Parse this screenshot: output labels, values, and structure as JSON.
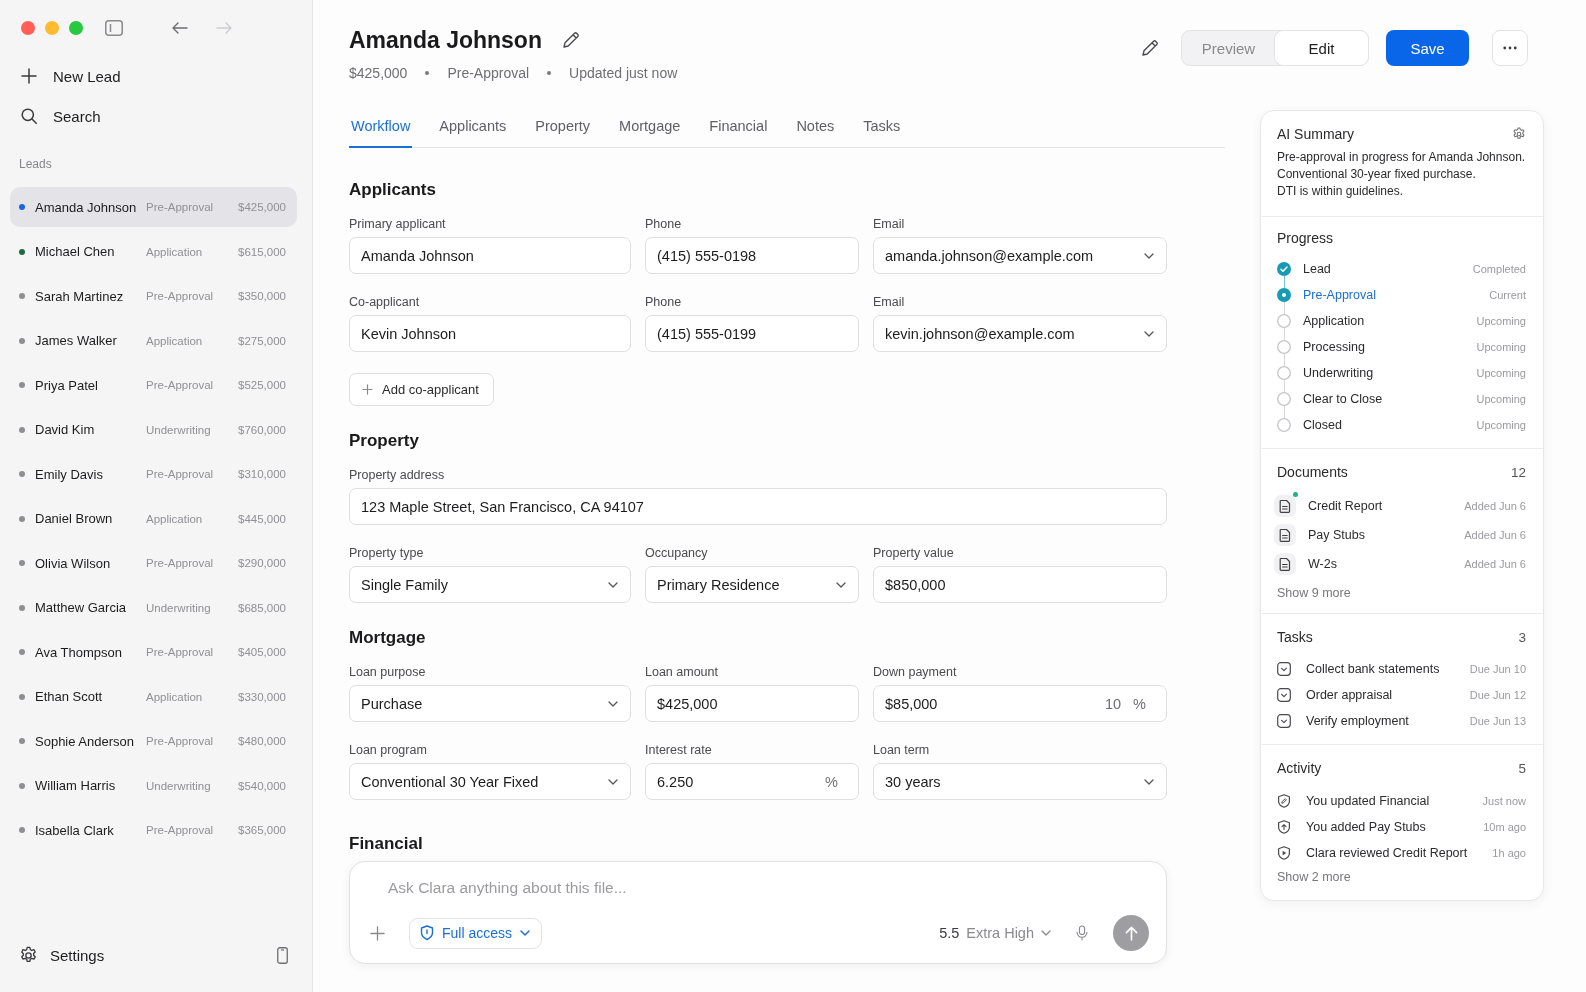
{
  "window": {
    "nav": [
      {
        "kind": "back",
        "disabled": false
      },
      {
        "kind": "forward",
        "disabled": true
      }
    ]
  },
  "sidebar": {
    "actions": [
      {
        "kind": "new",
        "label": "New Lead"
      },
      {
        "kind": "search",
        "label": "Search"
      }
    ],
    "section_label": "Leads",
    "leads": [
      {
        "name": "Amanda Johnson",
        "stage": "Pre-Approval",
        "amount": "$425,000",
        "color": "#1a66e0",
        "selected": true
      },
      {
        "name": "Michael Chen",
        "stage": "Application",
        "amount": "$615,000",
        "color": "#1c6b45",
        "selected": false
      },
      {
        "name": "Sarah Martinez",
        "stage": "Pre-Approval",
        "amount": "$350,000",
        "color": "#8e8e93",
        "selected": false
      },
      {
        "name": "James Walker",
        "stage": "Application",
        "amount": "$275,000",
        "color": "#8e8e93",
        "selected": false
      },
      {
        "name": "Priya Patel",
        "stage": "Pre-Approval",
        "amount": "$525,000",
        "color": "#8e8e93",
        "selected": false
      },
      {
        "name": "David Kim",
        "stage": "Underwriting",
        "amount": "$760,000",
        "color": "#8e8e93",
        "selected": false
      },
      {
        "name": "Emily Davis",
        "stage": "Pre-Approval",
        "amount": "$310,000",
        "color": "#8e8e93",
        "selected": false
      },
      {
        "name": "Daniel Brown",
        "stage": "Application",
        "amount": "$445,000",
        "color": "#8e8e93",
        "selected": false
      },
      {
        "name": "Olivia Wilson",
        "stage": "Pre-Approval",
        "amount": "$290,000",
        "color": "#8e8e93",
        "selected": false
      },
      {
        "name": "Matthew Garcia",
        "stage": "Underwriting",
        "amount": "$685,000",
        "color": "#8e8e93",
        "selected": false
      },
      {
        "name": "Ava Thompson",
        "stage": "Pre-Approval",
        "amount": "$405,000",
        "color": "#8e8e93",
        "selected": false
      },
      {
        "name": "Ethan Scott",
        "stage": "Application",
        "amount": "$330,000",
        "color": "#8e8e93",
        "selected": false
      },
      {
        "name": "Sophie Anderson",
        "stage": "Pre-Approval",
        "amount": "$480,000",
        "color": "#8e8e93",
        "selected": false
      },
      {
        "name": "William Harris",
        "stage": "Underwriting",
        "amount": "$540,000",
        "color": "#8e8e93",
        "selected": false
      },
      {
        "name": "Isabella Clark",
        "stage": "Pre-Approval",
        "amount": "$365,000",
        "color": "#8e8e93",
        "selected": false
      }
    ],
    "settings_label": "Settings"
  },
  "header": {
    "title": "Amanda Johnson",
    "meta": [
      "$425,000",
      "Pre-Approval",
      "Updated just now"
    ],
    "view_modes": [
      {
        "label": "Preview",
        "selected": false
      },
      {
        "label": "Edit",
        "selected": true
      }
    ],
    "save_label": "Save"
  },
  "tabs": [
    {
      "label": "Workflow",
      "selected": true
    },
    {
      "label": "Applicants",
      "selected": false
    },
    {
      "label": "Property",
      "selected": false
    },
    {
      "label": "Mortgage",
      "selected": false
    },
    {
      "label": "Financial",
      "selected": false
    },
    {
      "label": "Notes",
      "selected": false
    },
    {
      "label": "Tasks",
      "selected": false
    }
  ],
  "sections": [
    {
      "title": "Applicants",
      "rows": [
        [
          {
            "label": "Primary applicant",
            "value": "Amanda Johnson",
            "kind": "text"
          },
          {
            "label": "Phone",
            "value": "(415) 555-0198",
            "kind": "text"
          },
          {
            "label": "Email",
            "value": "amanda.johnson@example.com",
            "kind": "select"
          }
        ],
        [
          {
            "label": "Co-applicant",
            "value": "Kevin Johnson",
            "kind": "text"
          },
          {
            "label": "Phone",
            "value": "(415) 555-0199",
            "kind": "text"
          },
          {
            "label": "Email",
            "value": "kevin.johnson@example.com",
            "kind": "select"
          }
        ]
      ],
      "action": "Add co-applicant"
    },
    {
      "title": "Property",
      "rows": [
        [
          {
            "label": "Property address",
            "value": "123 Maple Street, San Francisco, CA 94107",
            "kind": "text"
          }
        ],
        [
          {
            "label": "Property type",
            "value": "Single Family",
            "kind": "select"
          },
          {
            "label": "Occupancy",
            "value": "Primary Residence",
            "kind": "select"
          },
          {
            "label": "Property value",
            "value": "$850,000",
            "kind": "text"
          }
        ]
      ]
    },
    {
      "title": "Mortgage",
      "rows": [
        [
          {
            "label": "Loan purpose",
            "value": "Purchase",
            "kind": "select"
          },
          {
            "label": "Loan amount",
            "value": "$425,000",
            "kind": "text"
          },
          {
            "label": "Down payment",
            "value": "$85,000",
            "kind": "unit",
            "addon": "10",
            "unit": "%"
          }
        ],
        [
          {
            "label": "Loan program",
            "value": "Conventional 30 Year Fixed",
            "kind": "select"
          },
          {
            "label": "Interest rate",
            "value": "6.250",
            "kind": "unit",
            "unit": "%"
          },
          {
            "label": "Loan term",
            "value": "30 years",
            "kind": "select"
          }
        ]
      ]
    },
    {
      "title": "Financial"
    }
  ],
  "composer": {
    "placeholder": "Ask Clara anything about this file...",
    "access_label": "Full access",
    "model": "5.5",
    "effort": "Extra High"
  },
  "summary": {
    "title": "AI Summary",
    "lines": [
      "Pre-approval in progress for Amanda Johnson.",
      "Conventional 30-year fixed purchase.",
      "DTI is within guidelines."
    ]
  },
  "progress": {
    "title": "Progress",
    "steps": [
      {
        "label": "Lead",
        "status": "Completed",
        "kind": "completed"
      },
      {
        "label": "Pre-Approval",
        "status": "Current",
        "kind": "current"
      },
      {
        "label": "Application",
        "status": "Upcoming",
        "kind": "upcoming"
      },
      {
        "label": "Processing",
        "status": "Upcoming",
        "kind": "upcoming"
      },
      {
        "label": "Underwriting",
        "status": "Upcoming",
        "kind": "upcoming"
      },
      {
        "label": "Clear to Close",
        "status": "Upcoming",
        "kind": "upcoming"
      },
      {
        "label": "Closed",
        "status": "Upcoming",
        "kind": "upcoming"
      }
    ]
  },
  "documents": {
    "title": "Documents",
    "count": "12",
    "items": [
      {
        "name": "Credit Report",
        "added": "Added Jun 6",
        "new": true
      },
      {
        "name": "Pay Stubs",
        "added": "Added Jun 6",
        "new": false
      },
      {
        "name": "W-2s",
        "added": "Added Jun 6",
        "new": false
      }
    ],
    "more": "Show 9 more"
  },
  "tasks": {
    "title": "Tasks",
    "count": "3",
    "items": [
      {
        "label": "Collect bank statements",
        "due": "Due Jun 10"
      },
      {
        "label": "Order appraisal",
        "due": "Due Jun 12"
      },
      {
        "label": "Verify employment",
        "due": "Due Jun 13"
      }
    ]
  },
  "activity": {
    "title": "Activity",
    "count": "5",
    "items": [
      {
        "text": "You updated Financial",
        "time": "Just now",
        "kind": "update"
      },
      {
        "text": "You added Pay Stubs",
        "time": "10m ago",
        "kind": "upload"
      },
      {
        "text": "Clara reviewed Credit Report",
        "time": "1h ago",
        "kind": "review"
      }
    ],
    "more": "Show 2 more"
  }
}
